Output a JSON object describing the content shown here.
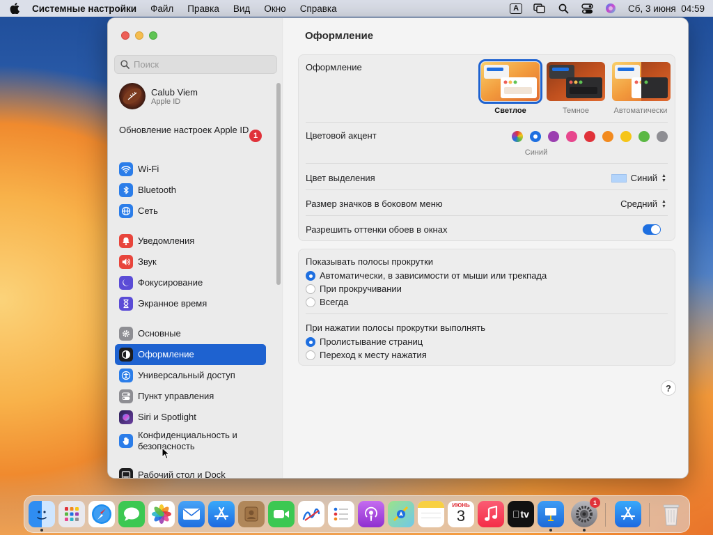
{
  "menubar": {
    "app": "Системные настройки",
    "items": [
      "Файл",
      "Правка",
      "Вид",
      "Окно",
      "Справка"
    ],
    "input_indicator": "A",
    "datetime": "Сб, 3 июня  04:59"
  },
  "sidebar": {
    "search_placeholder": "Поиск",
    "account": {
      "name": "Calub Viem",
      "subtitle": "Apple ID"
    },
    "update": {
      "label": "Обновление настроек Apple ID",
      "badge": "1"
    },
    "items": [
      {
        "label": "Wi-Fi",
        "icon": "wifi-icon",
        "color": "#2b7de9"
      },
      {
        "label": "Bluetooth",
        "icon": "bluetooth-icon",
        "color": "#2b7de9"
      },
      {
        "label": "Сеть",
        "icon": "globe-icon",
        "color": "#2b7de9"
      },
      {
        "label": "Уведомления",
        "icon": "bell-icon",
        "color": "#e8453c"
      },
      {
        "label": "Звук",
        "icon": "speaker-icon",
        "color": "#e8453c"
      },
      {
        "label": "Фокусирование",
        "icon": "moon-icon",
        "color": "#5b4cd6"
      },
      {
        "label": "Экранное время",
        "icon": "hourglass-icon",
        "color": "#5b4cd6"
      },
      {
        "label": "Основные",
        "icon": "gear-icon",
        "color": "#8e8e93"
      },
      {
        "label": "Оформление",
        "icon": "appearance-icon",
        "color": "#1d1d1f"
      },
      {
        "label": "Универсальный доступ",
        "icon": "accessibility-icon",
        "color": "#2b7de9"
      },
      {
        "label": "Пункт управления",
        "icon": "control-center-icon",
        "color": "#8e8e93"
      },
      {
        "label": "Siri и Spotlight",
        "icon": "siri-icon",
        "color": "#6b3fa0"
      },
      {
        "label": "Конфиденциальность и безопасность",
        "icon": "hand-icon",
        "color": "#2b7de9"
      },
      {
        "label": "Рабочий стол и Dock",
        "icon": "dock-icon",
        "color": "#1d1d1f"
      }
    ]
  },
  "content": {
    "title": "Оформление",
    "appearance": {
      "label": "Оформление",
      "options": [
        "Светлое",
        "Темное",
        "Автоматически"
      ],
      "selected": "Светлое"
    },
    "accent": {
      "label": "Цветовой акцент",
      "colors": [
        "multicolor",
        "#1e6fe0",
        "#9b3fb0",
        "#e7468d",
        "#e0323a",
        "#f28a1e",
        "#f5c518",
        "#5bb844",
        "#8e8e93"
      ],
      "selected_name": "Синий"
    },
    "highlight": {
      "label": "Цвет выделения",
      "value": "Синий",
      "swatch": "#b3d4fb"
    },
    "sidebar_icon_size": {
      "label": "Размер значков в боковом меню",
      "value": "Средний"
    },
    "wallpaper_tint": {
      "label": "Разрешить оттенки обоев в окнах",
      "on": true
    },
    "scrollbars": {
      "label": "Показывать полосы прокрутки",
      "options": [
        "Автоматически, в зависимости от мыши или трекпада",
        "При прокручивании",
        "Всегда"
      ],
      "selected": 0
    },
    "scroll_click": {
      "label": "При нажатии полосы прокрутки выполнять",
      "options": [
        "Пролистывание страниц",
        "Переход к месту нажатия"
      ],
      "selected": 0
    },
    "help": "?"
  },
  "dock": {
    "apps": [
      {
        "name": "Finder",
        "icon": "finder-icon"
      },
      {
        "name": "Launchpad",
        "icon": "launchpad-icon"
      },
      {
        "name": "Safari",
        "icon": "safari-icon"
      },
      {
        "name": "Messages",
        "icon": "messages-icon"
      },
      {
        "name": "Photos",
        "icon": "photos-icon"
      },
      {
        "name": "Mail",
        "icon": "mail-icon"
      },
      {
        "name": "App Store",
        "icon": "appstore-icon"
      },
      {
        "name": "Contacts",
        "icon": "contacts-icon"
      },
      {
        "name": "FaceTime",
        "icon": "facetime-icon"
      },
      {
        "name": "Freeform",
        "icon": "freeform-icon"
      },
      {
        "name": "Reminders",
        "icon": "reminders-icon"
      },
      {
        "name": "Podcasts",
        "icon": "podcasts-icon"
      },
      {
        "name": "Maps",
        "icon": "maps-icon"
      },
      {
        "name": "Notes",
        "icon": "notes-icon"
      },
      {
        "name": "Calendar",
        "icon": "calendar-icon",
        "month": "ИЮНЬ",
        "day": "3"
      },
      {
        "name": "Music",
        "icon": "music-icon"
      },
      {
        "name": "Apple TV",
        "icon": "tv-icon",
        "text": "tv"
      },
      {
        "name": "Keynote",
        "icon": "keynote-icon"
      },
      {
        "name": "System Settings",
        "icon": "settings-icon",
        "badge": "1"
      },
      {
        "name": "App Store Downloads",
        "icon": "downloads-icon"
      },
      {
        "name": "Trash",
        "icon": "trash-icon"
      }
    ]
  }
}
